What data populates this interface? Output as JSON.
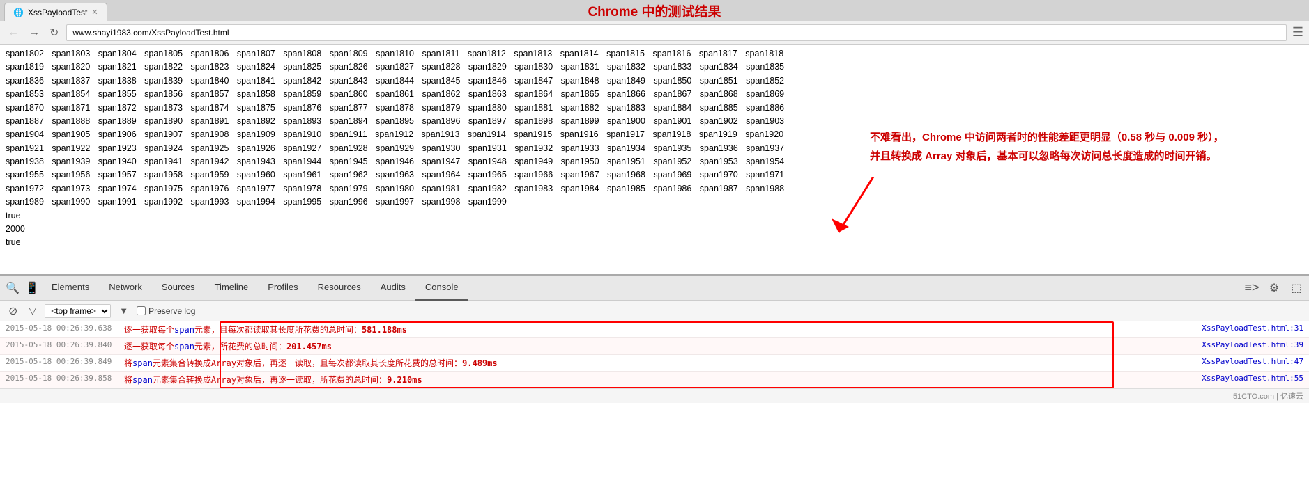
{
  "browser": {
    "tab_label": "XssPayloadTest",
    "address": "www.shayi1983.com/XssPayloadTest.html",
    "title": "Chrome 中的测试结果"
  },
  "page": {
    "span_lines": [
      "span1802 span1803 span1804 span1805 span1806 span1807 span1808 span1809 span1810 span1811 span1812 span1813 span1814 span1815 span1816 span1817 span1818",
      "span1819 span1820 span1821 span1822 span1823 span1824 span1825 span1826 span1827 span1828 span1829 span1830 span1831 span1832 span1833 span1834 span1835",
      "span1836 span1837 span1838 span1839 span1840 span1841 span1842 span1843 span1844 span1845 span1846 span1847 span1848 span1849 span1850 span1851 span1852",
      "span1853 span1854 span1855 span1856 span1857 span1858 span1859 span1860 span1861 span1862 span1863 span1864 span1865 span1866 span1867 span1868 span1869",
      "span1870 span1871 span1872 span1873 span1874 span1875 span1876 span1877 span1878 span1879 span1880 span1881 span1882 span1883 span1884 span1885 span1886",
      "span1887 span1888 span1889 span1890 span1891 span1892 span1893 span1894 span1895 span1896 span1897 span1898 span1899 span1900 span1901 span1902 span1903",
      "span1904 span1905 span1906 span1907 span1908 span1909 span1910 span1911 span1912 span1913 span1914 span1915 span1916 span1917 span1918 span1919 span1920",
      "span1921 span1922 span1923 span1924 span1925 span1926 span1927 span1928 span1929 span1930 span1931 span1932 span1933 span1934 span1935 span1936 span1937",
      "span1938 span1939 span1940 span1941 span1942 span1943 span1944 span1945 span1946 span1947 span1948 span1949 span1950 span1951 span1952 span1953 span1954",
      "span1955 span1956 span1957 span1958 span1959 span1960 span1961 span1962 span1963 span1964 span1965 span1966 span1967 span1968 span1969 span1970 span1971",
      "span1972 span1973 span1974 span1975 span1976 span1977 span1978 span1979 span1980 span1981 span1982 span1983 span1984 span1985 span1986 span1987 span1988",
      "span1989 span1990 span1991 span1992 span1993 span1994 span1995 span1996 span1997 span1998 span1999"
    ],
    "true1": "true",
    "num2000": "2000",
    "true2": "true",
    "annotation_line1": "不难看出，Chrome 中访问两者时的性能差距更明显（0.58 秒与 0.009 秒），",
    "annotation_line2": "并且转换成 Array 对象后，基本可以忽略每次访问总长度造成的时间开销。"
  },
  "devtools": {
    "tabs": [
      {
        "id": "elements",
        "label": "Elements"
      },
      {
        "id": "network",
        "label": "Network"
      },
      {
        "id": "sources",
        "label": "Sources"
      },
      {
        "id": "timeline",
        "label": "Timeline"
      },
      {
        "id": "profiles",
        "label": "Profiles"
      },
      {
        "id": "resources",
        "label": "Resources"
      },
      {
        "id": "audits",
        "label": "Audits"
      },
      {
        "id": "console",
        "label": "Console",
        "active": true
      }
    ],
    "console_toolbar": {
      "frame_label": "<top frame>",
      "preserve_label": "Preserve log"
    },
    "console_entries": [
      {
        "time": "2015-05-18  00:26:39.638",
        "msg_before": "逐一获取每个",
        "msg_span": "span",
        "msg_after": "元素，且每次都读取其长度所花费的总时间：",
        "msg_value": "581.188ms",
        "file": "XssPayloadTest.html:31"
      },
      {
        "time": "2015-05-18  00:26:39.840",
        "msg_before": "逐一获取每个",
        "msg_span": "span",
        "msg_after": "元素，所花费的总时间：",
        "msg_value": "201.457ms",
        "file": "XssPayloadTest.html:39"
      },
      {
        "time": "2015-05-18  00:26:39.849",
        "msg_before": "将",
        "msg_span": "span",
        "msg_after": "元素集合转换成Array对象后，再逐一读取，且每次都读取其长度所花费的总时间：",
        "msg_value": "9.489ms",
        "file": "XssPayloadTest.html:47"
      },
      {
        "time": "2015-05-18  00:26:39.858",
        "msg_before": "将",
        "msg_span": "span",
        "msg_after": "元素集合转换成Array对象后，再逐一读取，所花费的总时间：",
        "msg_value": "9.210ms",
        "file": "XssPayloadTest.html:55"
      }
    ]
  },
  "icons": {
    "back": "←",
    "forward": "→",
    "refresh": "↻",
    "search_icon": "🔍",
    "mobile_icon": "📱",
    "settings_icon": "⚙",
    "dock_icon": "⬚",
    "stop_icon": "⊘",
    "filter_icon": "▽",
    "dropdown_icon": "▼",
    "execute_icon": "≡",
    "expand_icon": "⊞"
  },
  "watermark": "51CTO.com | 亿速云"
}
